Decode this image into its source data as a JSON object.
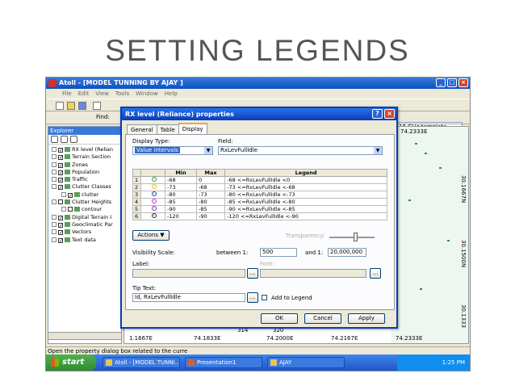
{
  "slide_title": "SETTING LEGENDS",
  "app": {
    "title": "Atoll - [MODEL TUNNING BY AJAY ]",
    "menu": [
      "File",
      "Edit",
      "View",
      "Tools",
      "Window",
      "Help"
    ],
    "find_label": "Find:",
    "template": "16 GHz template"
  },
  "explorer": {
    "title": "Explorer",
    "tree": [
      {
        "label": "RX level (Relian",
        "indent": 0,
        "checked": true
      },
      {
        "label": "Terrain Section",
        "indent": 0,
        "checked": true
      },
      {
        "label": "Zones",
        "indent": 0,
        "checked": true
      },
      {
        "label": "Population",
        "indent": 0,
        "checked": true
      },
      {
        "label": "Traffic",
        "indent": 0,
        "checked": true
      },
      {
        "label": "Clutter Classes",
        "indent": 0,
        "checked": true
      },
      {
        "label": "clutter",
        "indent": 1,
        "checked": true
      },
      {
        "label": "Clutter Heights",
        "indent": 0,
        "checked": false
      },
      {
        "label": "contour",
        "indent": 1,
        "checked": false
      },
      {
        "label": "Digital Terrain I",
        "indent": 0,
        "checked": true
      },
      {
        "label": "Geoclimatic Par",
        "indent": 0,
        "checked": true
      },
      {
        "label": "Vectors",
        "indent": 0,
        "checked": true
      },
      {
        "label": "Text data",
        "indent": 0,
        "checked": true
      }
    ]
  },
  "map": {
    "top_coord": "74.2333E",
    "bottom_coords": [
      "1.1667E",
      "74.1833E",
      "74.2000E",
      "74.2167E",
      "74.2333E"
    ],
    "right_coords": [
      "30.1667N",
      "30.1500N",
      "30.1333"
    ],
    "mid_labels": [
      "314",
      "320"
    ]
  },
  "status": "Open the property dialog box related to the curre",
  "taskbar": {
    "start": "start",
    "tasks": [
      "Atoll - [MODEL TUNNI...",
      "Presentation1",
      "AJAY"
    ],
    "clock": "1:25 PM"
  },
  "dialog": {
    "title": "RX level (Reliance) properties",
    "tabs": [
      "General",
      "Table",
      "Display"
    ],
    "active_tab": "Display",
    "display_type_label": "Display Type:",
    "display_type_value": "Value intervals",
    "field_label": "Field:",
    "field_value": "RxLevFullIdle",
    "columns": [
      "",
      "",
      "Min",
      "Max",
      "Legend"
    ],
    "rows": [
      {
        "n": "1",
        "color": "#2fa82f",
        "min": "-68",
        "max": "0",
        "legend": "-68 <=RxLevFullIdle <0"
      },
      {
        "n": "2",
        "color": "#e0c020",
        "min": "-73",
        "max": "-68",
        "legend": "-73 <=RxLevFullIdle <-68"
      },
      {
        "n": "3",
        "color": "#1f3fb0",
        "min": "-80",
        "max": "-73",
        "legend": "-80 <=RxLevFullIdle <-73"
      },
      {
        "n": "4",
        "color": "#d030c0",
        "min": "-85",
        "max": "-80",
        "legend": "-85 <=RxLevFullIdle <-80"
      },
      {
        "n": "5",
        "color": "#8030c0",
        "min": "-90",
        "max": "-85",
        "legend": "-90 <=RxLevFullIdle <-85"
      },
      {
        "n": "6",
        "color": "#202020",
        "min": "-120",
        "max": "-90",
        "legend": "-120 <=RxLevFullIdle <-90"
      }
    ],
    "actions_label": "Actions",
    "transparency_label": "Transparency:",
    "visibility_label": "Visibility Scale:",
    "between_label": "between 1:",
    "between_value": "500",
    "and_label": "and 1:",
    "and_value": "20,000,000",
    "label_label": "Label:",
    "font_label": "Font:",
    "tip_label": "Tip Text:",
    "tip_value": "Id, RxLevFullIdle",
    "browse": "...",
    "add_legend_label": "Add to Legend",
    "ok": "OK",
    "cancel": "Cancel",
    "apply": "Apply"
  }
}
